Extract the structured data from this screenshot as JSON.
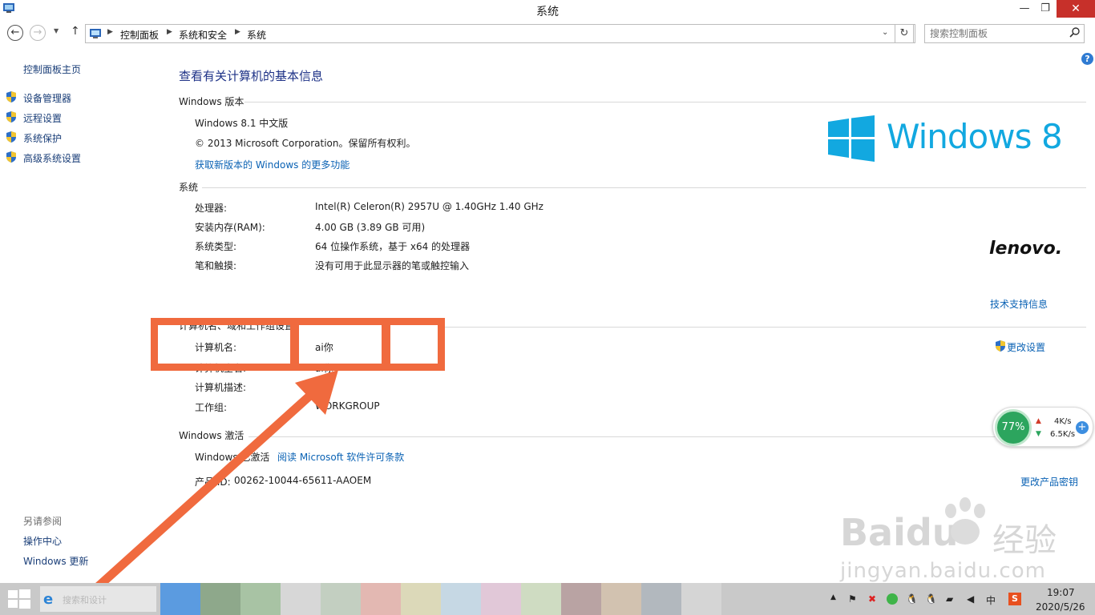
{
  "window": {
    "title": "系统",
    "minimize": "—",
    "maximize": "❐",
    "close": "✕"
  },
  "address_bar": {
    "breadcrumbs": [
      "控制面板",
      "系统和安全",
      "系统"
    ],
    "search_placeholder": "搜索控制面板"
  },
  "sidebar": {
    "home": "控制面板主页",
    "items": [
      "设备管理器",
      "远程设置",
      "系统保护",
      "高级系统设置"
    ],
    "see_also_label": "另请参阅",
    "see_also": [
      "操作中心",
      "Windows 更新"
    ]
  },
  "main": {
    "heading": "查看有关计算机的基本信息",
    "edition_section": "Windows 版本",
    "edition": "Windows 8.1 中文版",
    "copyright": "© 2013 Microsoft Corporation。保留所有权利。",
    "more_features_link": "获取新版本的 Windows 的更多功能",
    "windows_logo_text": "Windows",
    "windows_logo_num": "8",
    "system_section": "系统",
    "system_rows": [
      {
        "label": "处理器:",
        "value": "Intel(R) Celeron(R) 2957U @ 1.40GHz   1.40 GHz"
      },
      {
        "label": "安装内存(RAM):",
        "value": "4.00 GB (3.89 GB 可用)"
      },
      {
        "label": "系统类型:",
        "value": "64 位操作系统，基于 x64 的处理器"
      },
      {
        "label": "笔和触摸:",
        "value": "没有可用于此显示器的笔或触控输入"
      }
    ],
    "oem_logo": "lenovo.",
    "support_link": "技术支持信息",
    "computer_section": "计算机名、域和工作组设置",
    "computer_rows": [
      {
        "label": "计算机名:",
        "value": "ai你"
      },
      {
        "label": "计算机全名:",
        "value": "ai你"
      },
      {
        "label": "计算机描述:",
        "value": ""
      },
      {
        "label": "工作组:",
        "value": "WORKGROUP"
      }
    ],
    "change_settings_link": "更改设置",
    "activation_section": "Windows 激活",
    "activation_status": "Windows 已激活",
    "license_link": "阅读 Microsoft 软件许可条款",
    "product_id_label": "产品 ID:",
    "product_id": "00262-10044-65611-AAOEM",
    "change_key_link": "更改产品密钥"
  },
  "net_widget": {
    "percent": "77%",
    "up": "4K/s",
    "down": "6.5K/s"
  },
  "watermark": {
    "brand": "Baidu",
    "brand_cn": "经验",
    "url": "jingyan.baidu.com"
  },
  "taskbar": {
    "search_text": "搜索和设计",
    "ime": "中",
    "clock_time": "19:07",
    "clock_date": "2020/5/26"
  },
  "colors": {
    "annotation": "#f06a3e",
    "link": "#0a62b4",
    "heading": "#1e3287",
    "windows_blue": "#12a8e0"
  }
}
